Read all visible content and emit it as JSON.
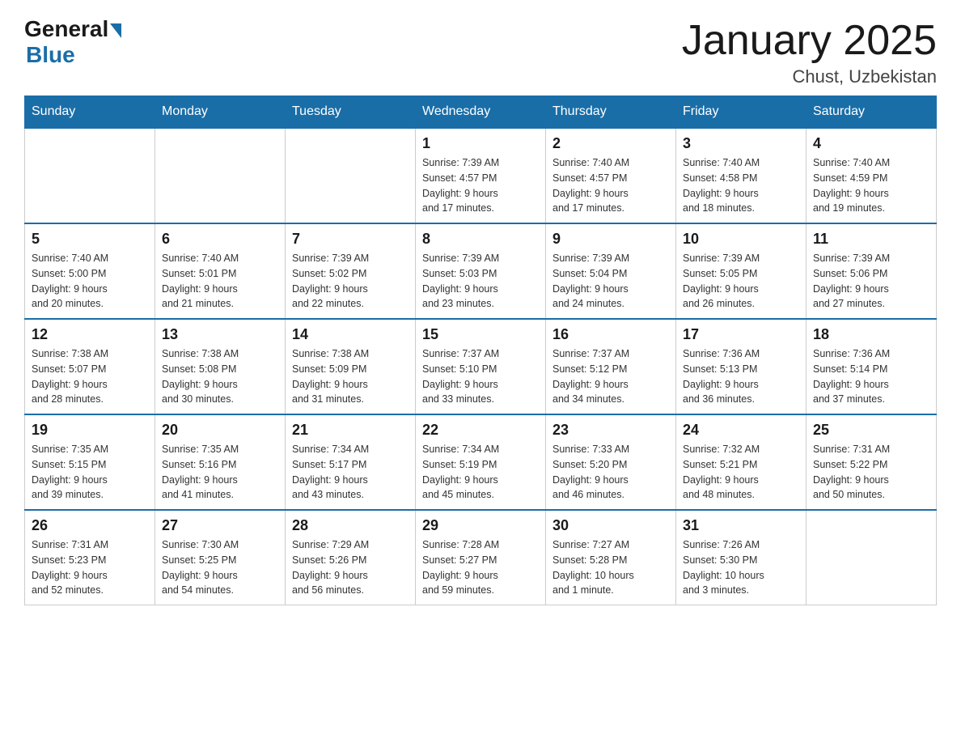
{
  "logo": {
    "general": "General",
    "blue": "Blue"
  },
  "title": "January 2025",
  "subtitle": "Chust, Uzbekistan",
  "days_of_week": [
    "Sunday",
    "Monday",
    "Tuesday",
    "Wednesday",
    "Thursday",
    "Friday",
    "Saturday"
  ],
  "weeks": [
    [
      {
        "day": "",
        "info": ""
      },
      {
        "day": "",
        "info": ""
      },
      {
        "day": "",
        "info": ""
      },
      {
        "day": "1",
        "info": "Sunrise: 7:39 AM\nSunset: 4:57 PM\nDaylight: 9 hours\nand 17 minutes."
      },
      {
        "day": "2",
        "info": "Sunrise: 7:40 AM\nSunset: 4:57 PM\nDaylight: 9 hours\nand 17 minutes."
      },
      {
        "day": "3",
        "info": "Sunrise: 7:40 AM\nSunset: 4:58 PM\nDaylight: 9 hours\nand 18 minutes."
      },
      {
        "day": "4",
        "info": "Sunrise: 7:40 AM\nSunset: 4:59 PM\nDaylight: 9 hours\nand 19 minutes."
      }
    ],
    [
      {
        "day": "5",
        "info": "Sunrise: 7:40 AM\nSunset: 5:00 PM\nDaylight: 9 hours\nand 20 minutes."
      },
      {
        "day": "6",
        "info": "Sunrise: 7:40 AM\nSunset: 5:01 PM\nDaylight: 9 hours\nand 21 minutes."
      },
      {
        "day": "7",
        "info": "Sunrise: 7:39 AM\nSunset: 5:02 PM\nDaylight: 9 hours\nand 22 minutes."
      },
      {
        "day": "8",
        "info": "Sunrise: 7:39 AM\nSunset: 5:03 PM\nDaylight: 9 hours\nand 23 minutes."
      },
      {
        "day": "9",
        "info": "Sunrise: 7:39 AM\nSunset: 5:04 PM\nDaylight: 9 hours\nand 24 minutes."
      },
      {
        "day": "10",
        "info": "Sunrise: 7:39 AM\nSunset: 5:05 PM\nDaylight: 9 hours\nand 26 minutes."
      },
      {
        "day": "11",
        "info": "Sunrise: 7:39 AM\nSunset: 5:06 PM\nDaylight: 9 hours\nand 27 minutes."
      }
    ],
    [
      {
        "day": "12",
        "info": "Sunrise: 7:38 AM\nSunset: 5:07 PM\nDaylight: 9 hours\nand 28 minutes."
      },
      {
        "day": "13",
        "info": "Sunrise: 7:38 AM\nSunset: 5:08 PM\nDaylight: 9 hours\nand 30 minutes."
      },
      {
        "day": "14",
        "info": "Sunrise: 7:38 AM\nSunset: 5:09 PM\nDaylight: 9 hours\nand 31 minutes."
      },
      {
        "day": "15",
        "info": "Sunrise: 7:37 AM\nSunset: 5:10 PM\nDaylight: 9 hours\nand 33 minutes."
      },
      {
        "day": "16",
        "info": "Sunrise: 7:37 AM\nSunset: 5:12 PM\nDaylight: 9 hours\nand 34 minutes."
      },
      {
        "day": "17",
        "info": "Sunrise: 7:36 AM\nSunset: 5:13 PM\nDaylight: 9 hours\nand 36 minutes."
      },
      {
        "day": "18",
        "info": "Sunrise: 7:36 AM\nSunset: 5:14 PM\nDaylight: 9 hours\nand 37 minutes."
      }
    ],
    [
      {
        "day": "19",
        "info": "Sunrise: 7:35 AM\nSunset: 5:15 PM\nDaylight: 9 hours\nand 39 minutes."
      },
      {
        "day": "20",
        "info": "Sunrise: 7:35 AM\nSunset: 5:16 PM\nDaylight: 9 hours\nand 41 minutes."
      },
      {
        "day": "21",
        "info": "Sunrise: 7:34 AM\nSunset: 5:17 PM\nDaylight: 9 hours\nand 43 minutes."
      },
      {
        "day": "22",
        "info": "Sunrise: 7:34 AM\nSunset: 5:19 PM\nDaylight: 9 hours\nand 45 minutes."
      },
      {
        "day": "23",
        "info": "Sunrise: 7:33 AM\nSunset: 5:20 PM\nDaylight: 9 hours\nand 46 minutes."
      },
      {
        "day": "24",
        "info": "Sunrise: 7:32 AM\nSunset: 5:21 PM\nDaylight: 9 hours\nand 48 minutes."
      },
      {
        "day": "25",
        "info": "Sunrise: 7:31 AM\nSunset: 5:22 PM\nDaylight: 9 hours\nand 50 minutes."
      }
    ],
    [
      {
        "day": "26",
        "info": "Sunrise: 7:31 AM\nSunset: 5:23 PM\nDaylight: 9 hours\nand 52 minutes."
      },
      {
        "day": "27",
        "info": "Sunrise: 7:30 AM\nSunset: 5:25 PM\nDaylight: 9 hours\nand 54 minutes."
      },
      {
        "day": "28",
        "info": "Sunrise: 7:29 AM\nSunset: 5:26 PM\nDaylight: 9 hours\nand 56 minutes."
      },
      {
        "day": "29",
        "info": "Sunrise: 7:28 AM\nSunset: 5:27 PM\nDaylight: 9 hours\nand 59 minutes."
      },
      {
        "day": "30",
        "info": "Sunrise: 7:27 AM\nSunset: 5:28 PM\nDaylight: 10 hours\nand 1 minute."
      },
      {
        "day": "31",
        "info": "Sunrise: 7:26 AM\nSunset: 5:30 PM\nDaylight: 10 hours\nand 3 minutes."
      },
      {
        "day": "",
        "info": ""
      }
    ]
  ]
}
